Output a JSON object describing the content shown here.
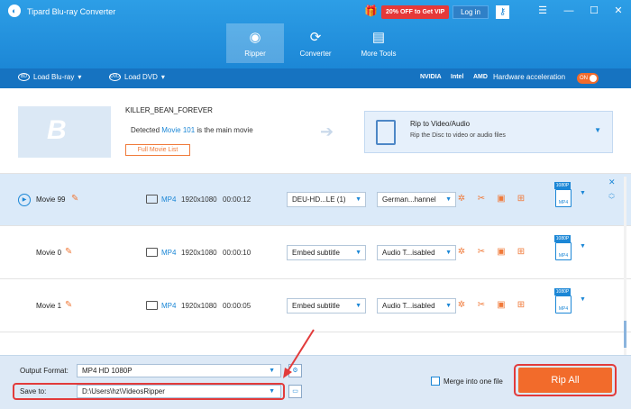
{
  "app": {
    "title": "Tipard Blu-ray Converter"
  },
  "header": {
    "promo": "20% OFF to Get VIP",
    "login": "Log in"
  },
  "nav": {
    "tabs": [
      {
        "label": "Ripper",
        "icon": "disc-icon"
      },
      {
        "label": "Converter",
        "icon": "convert-icon"
      },
      {
        "label": "More Tools",
        "icon": "toolbox-icon"
      }
    ]
  },
  "toolbar": {
    "load_bluray": "Load Blu-ray",
    "load_dvd": "Load DVD",
    "nvidia": "NVIDIA",
    "intel": "Intel",
    "amd": "AMD",
    "hw_accel": "Hardware acceleration",
    "toggle": "ON"
  },
  "movie": {
    "title": "KILLER_BEAN_FOREVER",
    "detected_prefix": "Detected ",
    "detected_link": "Movie 101",
    "detected_suffix": " is the main movie",
    "full_list": "Full Movie List"
  },
  "rip": {
    "title": "Rip to Video/Audio",
    "desc": "Rip the Disc to video or audio files"
  },
  "rows": [
    {
      "name": "Movie 99",
      "format": "MP4",
      "resolution": "1920x1080",
      "duration": "00:00:12",
      "subtitle": "DEU-HD...LE (1)",
      "audio": "German...hannel",
      "out_badge": "1080P",
      "out_fmt": "MP4"
    },
    {
      "name": "Movie 0",
      "format": "MP4",
      "resolution": "1920x1080",
      "duration": "00:00:10",
      "subtitle": "Embed subtitle",
      "audio": "Audio T...isabled",
      "out_badge": "1080P",
      "out_fmt": "MP4"
    },
    {
      "name": "Movie 1",
      "format": "MP4",
      "resolution": "1920x1080",
      "duration": "00:00:05",
      "subtitle": "Embed subtitle",
      "audio": "Audio T...isabled",
      "out_badge": "1080P",
      "out_fmt": "MP4"
    }
  ],
  "footer": {
    "output_label": "Output Format:",
    "output_value": "MP4 HD 1080P",
    "save_label": "Save to:",
    "save_value": "D:\\Users\\hz\\VideosRipper",
    "merge": "Merge into one file",
    "rip_all": "Rip All"
  },
  "colors": {
    "brand_blue": "#1c87d6",
    "accent_orange": "#f26b2b",
    "highlight_red": "#e23b3b"
  }
}
